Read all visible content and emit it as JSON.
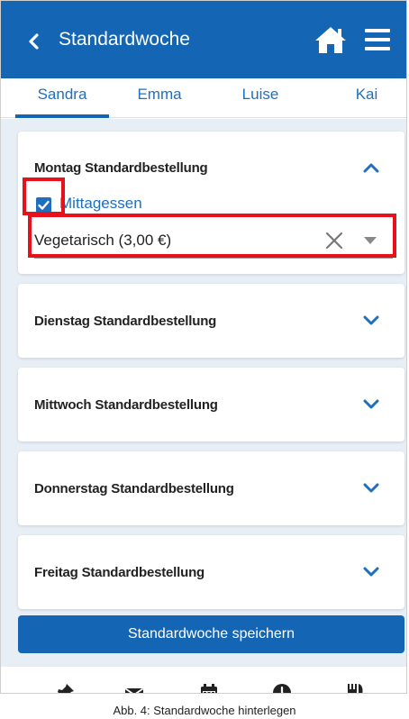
{
  "header": {
    "title": "Standardwoche"
  },
  "tabs": [
    {
      "label": "Sandra",
      "active": true
    },
    {
      "label": "Emma",
      "active": false
    },
    {
      "label": "Luise",
      "active": false
    },
    {
      "label": "Kai",
      "active": false
    }
  ],
  "days": [
    {
      "title": "Montag Standardbestellung",
      "expanded": true,
      "meal": {
        "label": "Mittagessen",
        "checked": true,
        "selection": "Vegetarisch (3,00 €)"
      }
    },
    {
      "title": "Dienstag Standardbestellung",
      "expanded": false
    },
    {
      "title": "Mittwoch Standardbestellung",
      "expanded": false
    },
    {
      "title": "Donnerstag Standardbestellung",
      "expanded": false
    },
    {
      "title": "Freitag Standardbestellung",
      "expanded": false
    }
  ],
  "actions": {
    "save_label": "Standardwoche speichern"
  },
  "bottom_nav": [
    "pin-icon",
    "mail-icon",
    "calendar-icon",
    "clock-icon",
    "cutlery-icon"
  ],
  "caption": "Abb. 4: Standardwoche hinterlegen",
  "colors": {
    "primary": "#1565b5",
    "link": "#1f6fbf",
    "highlight": "#e8101b",
    "background": "#e8eef5"
  }
}
